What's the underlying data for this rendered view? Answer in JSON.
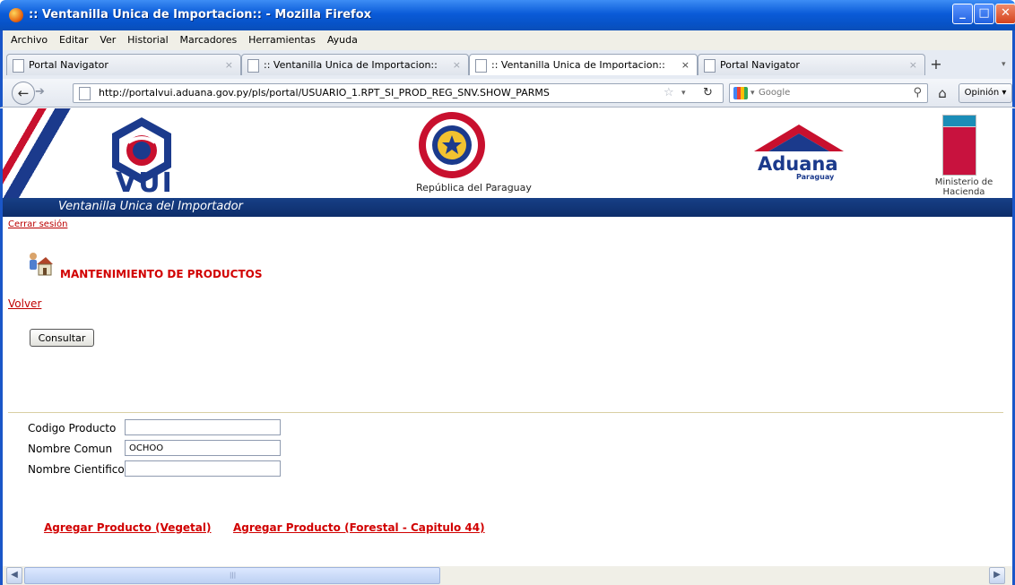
{
  "window": {
    "title": ":: Ventanilla Unica de Importacion:: - Mozilla Firefox"
  },
  "menu": [
    "Archivo",
    "Editar",
    "Ver",
    "Historial",
    "Marcadores",
    "Herramientas",
    "Ayuda"
  ],
  "tabs": [
    {
      "label": "Portal Navigator"
    },
    {
      "label": ":: Ventanilla Unica de Importacion::"
    },
    {
      "label": ":: Ventanilla Unica de Importacion::"
    },
    {
      "label": "Portal Navigator"
    }
  ],
  "tab_close_glyph": "×",
  "nav": {
    "url": "http://portalvui.aduana.gov.py/pls/portal/USUARIO_1.RPT_SI_PROD_REG_SNV.SHOW_PARMS",
    "search_placeholder": "Google",
    "opinion_label": "Opinión"
  },
  "banner": {
    "vui": "VUI",
    "republica": "República del Paraguay",
    "aduana": "Aduana",
    "aduana_sub": "Paraguay",
    "ministerio_line1": "Ministerio de",
    "ministerio_line2": "Hacienda",
    "strip_title": "Ventanilla Unica del Importador"
  },
  "page": {
    "logout": "Cerrar sesión",
    "section_title": "MANTENIMIENTO DE PRODUCTOS",
    "back": "Volver",
    "consult_button": "Consultar"
  },
  "form": {
    "codigo_label": "Codigo Producto",
    "codigo_value": "",
    "nombre_comun_label": "Nombre Comun",
    "nombre_comun_value": "OCHOO",
    "nombre_cientifico_label": "Nombre Cientifico",
    "nombre_cientifico_value": ""
  },
  "links": {
    "add_vegetal": "Agregar Producto (Vegetal)",
    "add_forestal": "Agregar Producto (Forestal - Capitulo 44)"
  },
  "colors": {
    "title_red": "#d10000",
    "vui_blue": "#1b3a8c",
    "xp_blue": "#0a5bd8"
  }
}
